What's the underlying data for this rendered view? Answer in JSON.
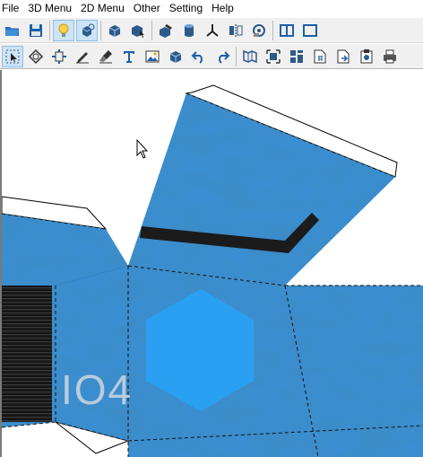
{
  "menu": [
    "File",
    "3D Menu",
    "2D Menu",
    "Other",
    "Setting",
    "Help"
  ],
  "toolbar1": [
    {
      "icon": "open-folder-icon"
    },
    {
      "icon": "save-disk-icon"
    },
    {
      "icon": "lightbulb-icon",
      "active": true
    },
    {
      "icon": "rotate-3d-icon",
      "active": true
    },
    {
      "icon": "cube-select-icon"
    },
    {
      "icon": "cube-pointer-icon"
    },
    {
      "icon": "paint-cube-icon"
    },
    {
      "icon": "cylinder-icon"
    },
    {
      "icon": "axis-icon"
    },
    {
      "icon": "mirror-icon"
    },
    {
      "icon": "texture-view-icon"
    },
    {
      "icon": "single-pane-icon"
    },
    {
      "icon": "split-pane-icon"
    }
  ],
  "toolbar2": [
    {
      "icon": "select-pointer-icon",
      "active": true
    },
    {
      "icon": "rotate-shape-icon"
    },
    {
      "icon": "resize-icon"
    },
    {
      "icon": "pen-line-icon"
    },
    {
      "icon": "brush-icon"
    },
    {
      "icon": "text-tool-icon"
    },
    {
      "icon": "image-icon"
    },
    {
      "icon": "cube-icon"
    },
    {
      "icon": "undo-icon"
    },
    {
      "icon": "redo-icon"
    },
    {
      "icon": "unfold-map-icon"
    },
    {
      "icon": "fit-view-icon"
    },
    {
      "icon": "grid-layout-icon"
    },
    {
      "icon": "page-number-icon"
    },
    {
      "icon": "page-export-icon"
    },
    {
      "icon": "clipboard-icon"
    },
    {
      "icon": "printer-icon"
    }
  ],
  "canvas": {
    "label": "IO4",
    "colors": {
      "paper": "#3a8fd6",
      "hexagon": "#2aa0f2",
      "stripe": "#1b1b1b",
      "flap": "#ffffff"
    }
  }
}
